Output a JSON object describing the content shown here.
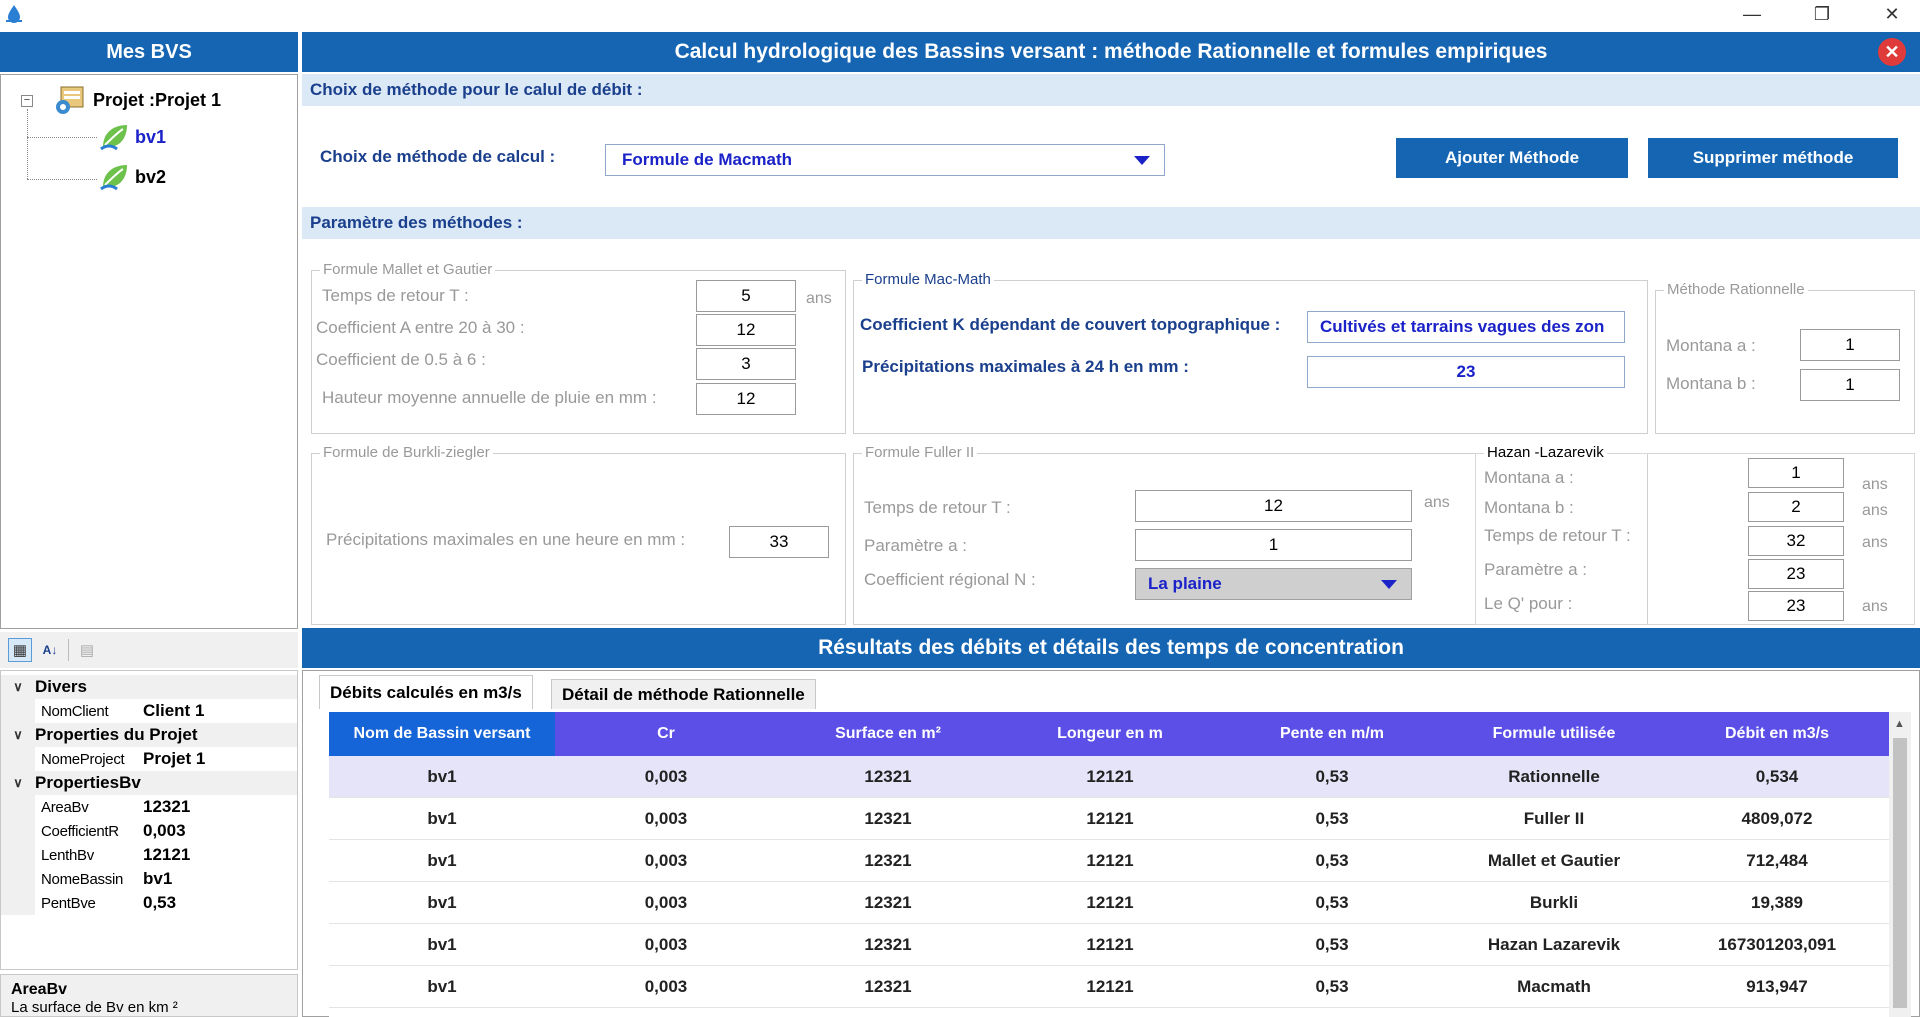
{
  "window": {
    "minimize": "—",
    "restore": "❐",
    "close": "✕"
  },
  "left": {
    "title": "Mes BVS",
    "tree": {
      "project_label": "Projet :Projet 1",
      "children": [
        "bv1",
        "bv2"
      ]
    },
    "properties": {
      "categories": [
        {
          "name": "Divers",
          "rows": [
            {
              "k": "NomClient",
              "v": "Client 1"
            }
          ]
        },
        {
          "name": "Properties du Projet",
          "rows": [
            {
              "k": "NomeProject",
              "v": "Projet 1"
            }
          ]
        },
        {
          "name": "PropertiesBv",
          "rows": [
            {
              "k": "AreaBv",
              "v": "12321"
            },
            {
              "k": "CoefficientR",
              "v": "0,003"
            },
            {
              "k": "LenthBv",
              "v": "12121"
            },
            {
              "k": "NomeBassin",
              "v": "bv1"
            },
            {
              "k": "PentBve",
              "v": "0,53"
            }
          ]
        }
      ],
      "description_title": "AreaBv",
      "description_text": "La surface de Bv en km ²"
    }
  },
  "main": {
    "title": "Calcul hydrologique des Bassins versant : méthode Rationnelle et formules empiriques",
    "section_choice": "Choix de méthode pour le calul de débit   :",
    "method_label": "Choix de méthode de calcul  :",
    "method_value": "Formule de Macmath",
    "add_button": "Ajouter Méthode",
    "delete_button": "Supprimer méthode",
    "section_params": "Paramètre des méthodes :",
    "mallet": {
      "legend": "Formule Mallet et Gautier",
      "rows": [
        {
          "label": "Temps de retour T :",
          "value": "5",
          "unit": "ans"
        },
        {
          "label": "Coefficient A entre  20 à 30 :",
          "value": "12",
          "unit": ""
        },
        {
          "label": "Coefficient de 0.5 à 6  :",
          "value": "3",
          "unit": ""
        },
        {
          "label": "Hauteur moyenne annuelle de pluie en mm :",
          "value": "12",
          "unit": ""
        }
      ]
    },
    "macmath": {
      "legend": "Formule Mac-Math",
      "k_label": "Coefficient K dépendant de couvert topographique :",
      "k_value": "Cultivés et tarrains vagues des zon",
      "p_label": "Précipitations maximales à 24 h en mm :",
      "p_value": "23"
    },
    "rationnelle": {
      "legend": "Méthode Rationnelle",
      "a_label": "Montana a :",
      "a_value": "1",
      "b_label": "Montana b :",
      "b_value": "1"
    },
    "burkli": {
      "legend": "Formule de Burkli-ziegler",
      "label": "Précipitations maximales en une heure en mm :",
      "value": "33"
    },
    "fuller": {
      "legend": "Formule Fuller II",
      "t_label": "Temps de retour T :",
      "t_value": "12",
      "t_unit": "ans",
      "a_label": "Paramètre a :",
      "a_value": "1",
      "n_label": "Coefficient régional N :",
      "n_value": "La plaine"
    },
    "hazan": {
      "legend": "Hazan -Lazarevik",
      "rows": [
        {
          "label": "Montana a :",
          "value": "1",
          "unit": "ans"
        },
        {
          "label": "Montana b :",
          "value": "2",
          "unit": "ans"
        },
        {
          "label": "Temps de retour T :",
          "value": "32",
          "unit": "ans"
        },
        {
          "label": "Paramètre a :",
          "value": "23",
          "unit": ""
        },
        {
          "label": "Le Q' pour :",
          "value": "23",
          "unit": "ans"
        }
      ]
    },
    "results_title": "Résultats des débits et détails des temps de concentration",
    "tabs": [
      "Débits calculés en m3/s",
      "Détail de méthode Rationnelle"
    ],
    "table": {
      "headers": [
        "Nom de Bassin versant",
        "Cr",
        "Surface en m²",
        "Longeur en m",
        "Pente en m/m",
        "Formule utilisée",
        "Débit en m3/s"
      ],
      "rows": [
        [
          "bv1",
          "0,003",
          "12321",
          "12121",
          "0,53",
          "Rationnelle",
          "0,534"
        ],
        [
          "bv1",
          "0,003",
          "12321",
          "12121",
          "0,53",
          "Fuller II",
          "4809,072"
        ],
        [
          "bv1",
          "0,003",
          "12321",
          "12121",
          "0,53",
          "Mallet et Gautier",
          "712,484"
        ],
        [
          "bv1",
          "0,003",
          "12321",
          "12121",
          "0,53",
          "Burkli",
          "19,389"
        ],
        [
          "bv1",
          "0,003",
          "12321",
          "12121",
          "0,53",
          "Hazan Lazarevik",
          "167301203,091"
        ],
        [
          "bv1",
          "0,003",
          "12321",
          "12121",
          "0,53",
          "Macmath",
          "913,947"
        ]
      ]
    }
  },
  "colors": {
    "accent": "#1565b3",
    "header_purple": "#5b4fe8",
    "header_first": "#1565d8",
    "band": "#dbe8f6",
    "label_blue": "#1a3f8c",
    "combo_text": "#1a22c8"
  }
}
